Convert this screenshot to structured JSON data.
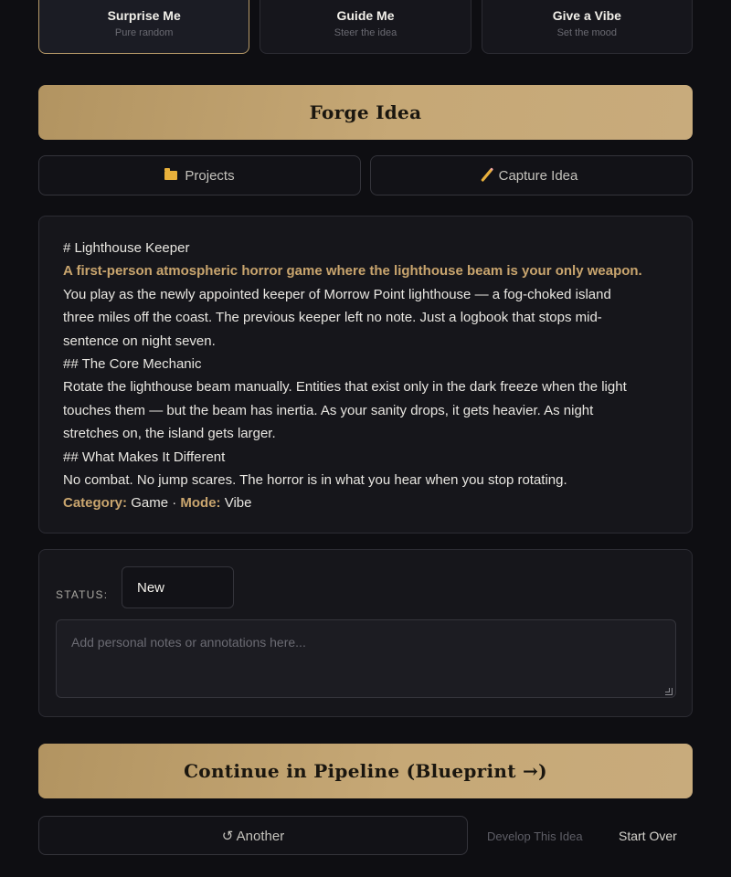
{
  "modes": [
    {
      "title": "Surprise Me",
      "subtitle": "Pure random",
      "active": true
    },
    {
      "title": "Guide Me",
      "subtitle": "Steer the idea",
      "active": false
    },
    {
      "title": "Give a Vibe",
      "subtitle": "Set the mood",
      "active": false
    }
  ],
  "actions": {
    "forge_label": "Forge Idea",
    "projects_label": "Projects",
    "capture_label": "Capture Idea"
  },
  "idea": {
    "heading": "# Lighthouse Keeper",
    "tagline": "A first-person atmospheric horror game where the lighthouse beam is your only weapon.",
    "intro_lines": [
      "You play as the newly appointed keeper of Morrow Point lighthouse — a fog-choked island",
      "three miles off the coast. The previous keeper left no note. Just a logbook that stops mid-",
      "sentence on night seven."
    ],
    "section1_heading": "## The Core Mechanic",
    "section1_lines": [
      "Rotate the lighthouse beam manually. Entities that exist only in the dark freeze when the light",
      "touches them — but the beam has inertia. As your sanity drops, it gets heavier. As night",
      "stretches on, the island gets larger."
    ],
    "section2_heading": "## What Makes It Different",
    "section2_lines": [
      "No combat. No jump scares. The horror is in what you hear when you stop rotating."
    ],
    "category_key": "Category:",
    "category_value": "Game",
    "separator": "·",
    "mode_key": "Mode:",
    "mode_value": "Vibe"
  },
  "status": {
    "label": "STATUS:",
    "value": "New",
    "notes_placeholder": "Add personal notes or annotations here..."
  },
  "footer": {
    "continue_label": "Continue in Pipeline (Blueprint →)",
    "another_label": "↺ Another",
    "develop_label": "Develop This Idea",
    "start_over_label": "Start Over"
  },
  "colors": {
    "accent_gold": "#c6a876",
    "background": "#0e0e12",
    "card": "#16161b"
  }
}
